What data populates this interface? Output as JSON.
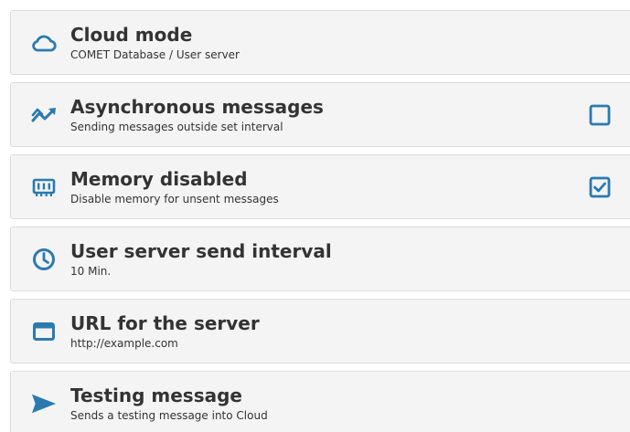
{
  "accent_color": "#2a7ab0",
  "text_color": "#333333",
  "settings": [
    {
      "icon": "cloud-icon",
      "title": "Cloud mode",
      "subtitle": "COMET Database / User server"
    },
    {
      "icon": "trend-arrows-icon",
      "title": "Asynchronous messages",
      "subtitle": "Sending messages outside set interval",
      "checkbox": {
        "checked": false
      }
    },
    {
      "icon": "memory-chip-icon",
      "title": "Memory disabled",
      "subtitle": "Disable memory for unsent messages",
      "checkbox": {
        "checked": true
      }
    },
    {
      "icon": "clock-icon",
      "title": "User server send interval",
      "subtitle": "10 Min."
    },
    {
      "icon": "browser-window-icon",
      "title": "URL for the server",
      "subtitle": "http://example.com"
    },
    {
      "icon": "send-icon",
      "title": "Testing message",
      "subtitle": "Sends a testing message into Cloud"
    }
  ]
}
